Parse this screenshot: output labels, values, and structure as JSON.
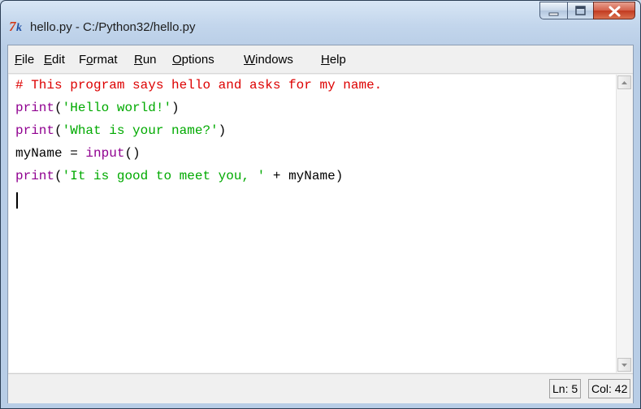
{
  "window": {
    "title": "hello.py - C:/Python32/hello.py",
    "icon": "python-idle-icon",
    "controls": [
      "minimize-icon",
      "maximize-icon",
      "close-icon"
    ]
  },
  "menubar": {
    "items": [
      {
        "label": "File",
        "accel": "F"
      },
      {
        "label": "Edit",
        "accel": "E"
      },
      {
        "label": "Format",
        "accel": "o"
      },
      {
        "label": "Run",
        "accel": "R"
      },
      {
        "label": "Options",
        "accel": "O"
      },
      {
        "label": "Windows",
        "accel": "W"
      },
      {
        "label": "Help",
        "accel": "H"
      }
    ]
  },
  "editor": {
    "lines": [
      "# This program says hello and asks for my name.",
      "print('Hello world!')",
      "print('What is your name?')",
      "myName = input()",
      "print('It is good to meet you, ' + myName)"
    ],
    "colors": {
      "comment": "#dd0000",
      "builtin": "#900090",
      "string": "#00aa00",
      "default": "#000000"
    }
  },
  "status": {
    "line": "Ln: 5",
    "col": "Col: 42"
  }
}
